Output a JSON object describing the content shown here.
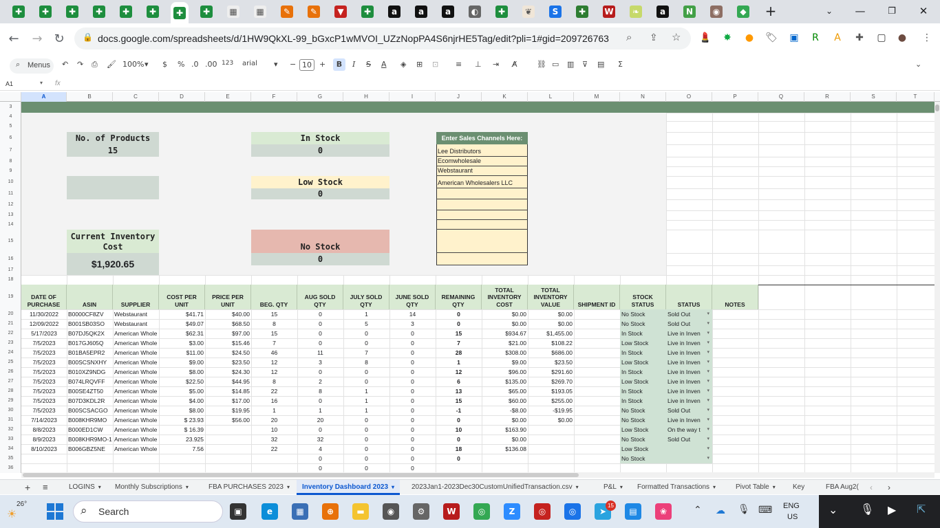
{
  "browser": {
    "tab_icons": [
      "sheets-icon",
      "sheets-icon",
      "sheets-icon",
      "sheets-icon",
      "sheets-icon",
      "sheets-icon",
      "sheets-icon",
      "sheets-icon",
      "image-icon",
      "image-icon",
      "pen-icon",
      "pen-icon",
      "vertex-icon",
      "sheets-icon",
      "amazon-icon",
      "amazon-icon",
      "amazon-icon",
      "globe-icon",
      "sheets-icon",
      "plant-icon",
      "sysco-icon",
      "puzzle-icon",
      "ww-icon",
      "leaf-icon",
      "amazon-icon",
      "n-icon",
      "seal-icon",
      "maps-icon"
    ],
    "new_tab_label": "+",
    "url": "docs.google.com/spreadsheets/d/1HW9QkXL-99_bGxcP1wMVOI_UZzNopPA4S6njrHE5Tag/edit?pli=1#gid=209726763"
  },
  "toolbar": {
    "menus_label": "Menus",
    "zoom": "100%",
    "currency": "$",
    "percent": "%",
    "dec_dec": ".0",
    "dec_inc": ".00",
    "numfmt": "123",
    "font": "arial",
    "font_size": "10"
  },
  "formula_bar": {
    "cell_ref": "A1",
    "fx": "fx"
  },
  "columns": [
    "A",
    "B",
    "C",
    "D",
    "E",
    "F",
    "G",
    "H",
    "I",
    "J",
    "K",
    "L",
    "M",
    "N",
    "O",
    "P",
    "Q",
    "R",
    "S",
    "T"
  ],
  "rows": [
    "3",
    "4",
    "5",
    "6",
    "7",
    "8",
    "9",
    "10",
    "11",
    "12",
    "13",
    "14",
    "15",
    "16",
    "17",
    "18",
    "19",
    "20",
    "21",
    "22",
    "23",
    "24",
    "25",
    "26",
    "27",
    "28",
    "29",
    "30",
    "31",
    "32",
    "33",
    "34",
    "35",
    "36"
  ],
  "dashboard": {
    "products_label": "No. of Products",
    "products_value": "15",
    "in_stock_label": "In Stock",
    "in_stock_value": "0",
    "low_stock_label": "Low Stock",
    "low_stock_value": "0",
    "cost_label_1": "Current Inventory",
    "cost_label_2": "Cost",
    "cost_value": "$1,920.65",
    "no_stock_label": "No Stock",
    "no_stock_value": "0",
    "channels_header": "Enter Sales Channels Here:",
    "channels": [
      "Lee Distributors",
      "Ecomwholesale",
      "Webstaurant",
      "American Wholesalers LLC"
    ]
  },
  "table": {
    "headers": [
      [
        "DATE OF",
        "PURCHASE"
      ],
      [
        "ASIN"
      ],
      [
        "SUPPLIER"
      ],
      [
        "COST PER",
        "UNIT"
      ],
      [
        "PRICE PER",
        "UNIT"
      ],
      [
        "BEG. QTY"
      ],
      [
        "AUG SOLD",
        "QTY"
      ],
      [
        "JULY SOLD",
        "QTY"
      ],
      [
        "JUNE SOLD",
        "QTY"
      ],
      [
        "REMAINING",
        "QTY"
      ],
      [
        "TOTAL",
        "INVENTORY",
        "COST"
      ],
      [
        "TOTAL",
        "INVENTORY",
        "VALUE"
      ],
      [
        "SHIPMENT ID"
      ],
      [
        "STOCK",
        "STATUS"
      ],
      [
        "STATUS"
      ],
      [
        "NOTES"
      ]
    ],
    "rows": [
      [
        "11/30/2022",
        "B0000CF8ZV",
        "Webstaurant",
        "$41.71",
        "$40.00",
        "15",
        "0",
        "1",
        "14",
        "0",
        "$0.00",
        "$0.00",
        "",
        "No Stock",
        "Sold Out",
        ""
      ],
      [
        "12/09/2022",
        "B001SB03SO",
        "Webstaurant",
        "$49.07",
        "$68.50",
        "8",
        "0",
        "5",
        "3",
        "0",
        "$0.00",
        "$0.00",
        "",
        "No Stock",
        "Sold Out",
        ""
      ],
      [
        "5/17/2023",
        "B07DJ5QK2X",
        "American Whole",
        "$62.31",
        "$97.00",
        "15",
        "0",
        "0",
        "0",
        "15",
        "$934.67",
        "$1,455.00",
        "",
        "In Stock",
        "Live in Inven",
        ""
      ],
      [
        "7/5/2023",
        "B017GJ605Q",
        "American Whole",
        "$3.00",
        "$15.46",
        "7",
        "0",
        "0",
        "0",
        "7",
        "$21.00",
        "$108.22",
        "",
        "Low Stock",
        "Live in Inven",
        ""
      ],
      [
        "7/5/2023",
        "B01BA5EPR2",
        "American Whole",
        "$11.00",
        "$24.50",
        "46",
        "11",
        "7",
        "0",
        "28",
        "$308.00",
        "$686.00",
        "",
        "In Stock",
        "Live in Inven",
        ""
      ],
      [
        "7/5/2023",
        "B00SCSNXHY",
        "American Whole",
        "$9.00",
        "$23.50",
        "12",
        "3",
        "8",
        "0",
        "1",
        "$9.00",
        "$23.50",
        "",
        "Low Stock",
        "Live in Inven",
        ""
      ],
      [
        "7/5/2023",
        "B010XZ9NDG",
        "American Whole",
        "$8.00",
        "$24.30",
        "12",
        "0",
        "0",
        "0",
        "12",
        "$96.00",
        "$291.60",
        "",
        "In Stock",
        "Live in Inven",
        ""
      ],
      [
        "7/5/2023",
        "B074LRQVFF",
        "American Whole",
        "$22.50",
        "$44.95",
        "8",
        "2",
        "0",
        "0",
        "6",
        "$135.00",
        "$269.70",
        "",
        "Low Stock",
        "Live in Inven",
        ""
      ],
      [
        "7/5/2023",
        "B00SE4ZT50",
        "American Whole",
        "$5.00",
        "$14.85",
        "22",
        "8",
        "1",
        "0",
        "13",
        "$65.00",
        "$193.05",
        "",
        "In Stock",
        "Live in Inven",
        ""
      ],
      [
        "7/5/2023",
        "B07D3KDL2R",
        "American Whole",
        "$4.00",
        "$17.00",
        "16",
        "0",
        "1",
        "0",
        "15",
        "$60.00",
        "$255.00",
        "",
        "In Stock",
        "Live in Inven",
        ""
      ],
      [
        "7/5/2023",
        "B00SCSACGO",
        "American Whole",
        "$8.00",
        "$19.95",
        "1",
        "1",
        "1",
        "0",
        "-1",
        "-$8.00",
        "-$19.95",
        "",
        "No Stock",
        "Sold Out",
        ""
      ],
      [
        "7/14/2023",
        "B008KHR9MO",
        "American Whole",
        "$      23.93",
        "$56.00",
        "20",
        "20",
        "0",
        "0",
        "0",
        "$0.00",
        "$0.00",
        "",
        "No Stock",
        "Live in Inven",
        ""
      ],
      [
        "8/8/2023",
        "B000ED1CW",
        "American Whole",
        "$      16.39",
        "",
        "10",
        "0",
        "0",
        "0",
        "10",
        "$163.90",
        "",
        "",
        "Low Stock",
        "On the way t",
        ""
      ],
      [
        "8/9/2023",
        "B008KHR9MO-1",
        "American Whole",
        "23.925",
        "",
        "32",
        "32",
        "0",
        "0",
        "0",
        "$0.00",
        "",
        "",
        "No Stock",
        "Sold Out",
        ""
      ],
      [
        "8/10/2023",
        "B006GBZ5NE",
        "American Whole",
        "7.56",
        "",
        "22",
        "4",
        "0",
        "0",
        "18",
        "$136.08",
        "",
        "",
        "Low Stock",
        "",
        ""
      ],
      [
        "",
        "",
        "",
        "",
        "",
        "",
        "0",
        "0",
        "0",
        "0",
        "",
        "",
        "",
        "No Stock",
        "",
        ""
      ],
      [
        "",
        "",
        "",
        "",
        "",
        "",
        "0",
        "0",
        "0",
        "",
        "",
        "",
        "",
        "",
        "",
        ""
      ]
    ]
  },
  "sheet_tabs": [
    "LOGINS",
    "Monthly Subscriptions",
    "FBA PURCHASES 2023",
    "Inventory Dashboard 2023",
    "2023Jan1-2023Dec30CustomUnifiedTransaction.csv",
    "P&L",
    "Formatted Transactions",
    "Pivot Table",
    "Key",
    "FBA Aug2("
  ],
  "taskbar": {
    "temp": "26°",
    "search": "Search",
    "lang_1": "ENG",
    "lang_2": "US",
    "badge": "15"
  },
  "colors": {
    "green_band": "#6b8f71",
    "pale_green": "#d9ead3",
    "grey_green": "#cfd9d2",
    "pale_yellow": "#fff2cc",
    "pale_red": "#e6b8af",
    "channel_fill": "#fff2cc",
    "channel_header": "#6b8f71",
    "table_header": "#d9ead3",
    "status_fill": "#cfe2d4"
  }
}
